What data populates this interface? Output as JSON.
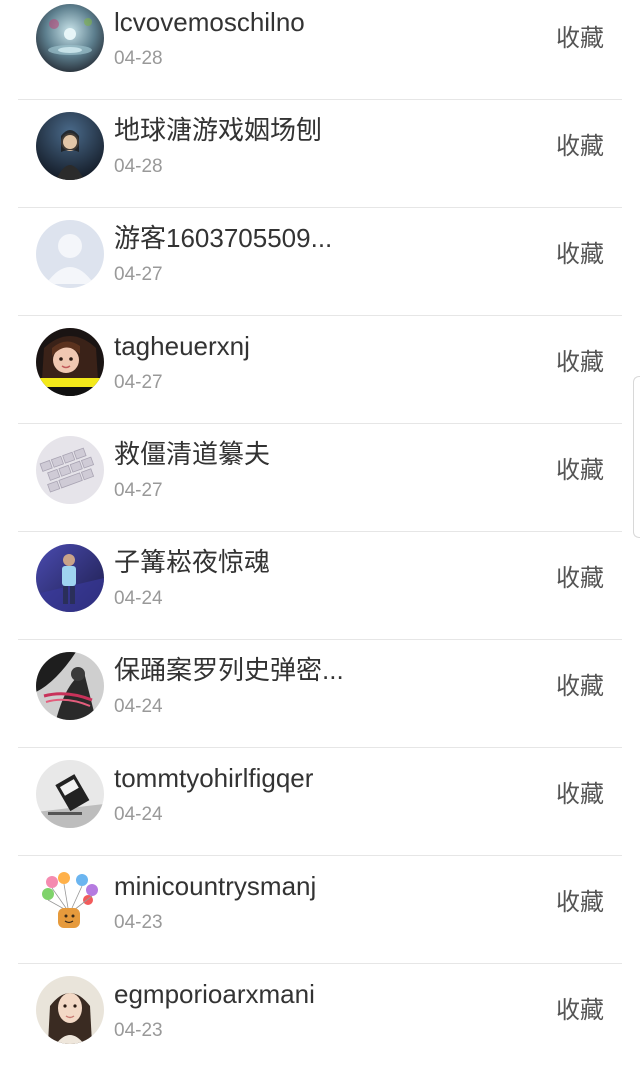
{
  "items": [
    {
      "name": "lcvovemoschilno",
      "date": "04-28",
      "action": "收藏",
      "avatar": "water-drop"
    },
    {
      "name": "地球溏游戏姻场刨",
      "date": "04-28",
      "action": "收藏",
      "avatar": "night-portrait"
    },
    {
      "name": "游客1603705509...",
      "date": "04-27",
      "action": "收藏",
      "avatar": "default-user"
    },
    {
      "name": "tagheuerxnj",
      "date": "04-27",
      "action": "收藏",
      "avatar": "girl-portrait"
    },
    {
      "name": "救僵清道纂夫",
      "date": "04-27",
      "action": "收藏",
      "avatar": "keyboard"
    },
    {
      "name": "子篝崧夜惊魂",
      "date": "04-24",
      "action": "收藏",
      "avatar": "person-standing"
    },
    {
      "name": "保踊案罗列史弹密...",
      "date": "04-24",
      "action": "收藏",
      "avatar": "dark-figure"
    },
    {
      "name": "tommtyohirlfigqer",
      "date": "04-24",
      "action": "收藏",
      "avatar": "grayscale-photo"
    },
    {
      "name": "minicountrysmanj",
      "date": "04-23",
      "action": "收藏",
      "avatar": "balloons"
    },
    {
      "name": "egmporioarxmani",
      "date": "04-23",
      "action": "收藏",
      "avatar": "woman-portrait"
    }
  ]
}
